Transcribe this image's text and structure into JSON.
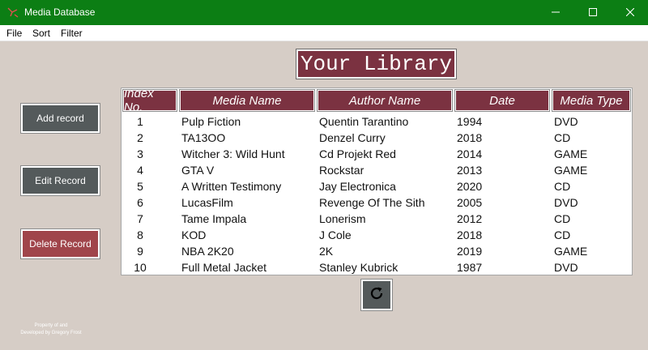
{
  "window": {
    "title": "Media Database",
    "icons": {
      "app": "app-icon",
      "minimize": "minimize-icon",
      "maximize": "maximize-icon",
      "close": "close-icon"
    },
    "colors": {
      "titlebar": "#0c7e14",
      "background": "#d6cdc6",
      "accent": "#7b3241",
      "button": "#545a5b",
      "danger": "#a0454b"
    }
  },
  "menu": {
    "file": "File",
    "sort": "Sort",
    "filter": "Filter"
  },
  "library_title": "Your Library",
  "buttons": {
    "add": "Add record",
    "edit": "Edit Record",
    "delete": "Delete Record",
    "refresh_icon": "refresh-icon"
  },
  "table": {
    "headers": {
      "index": "Index No.",
      "name": "Media Name",
      "author": "Author Name",
      "date": "Date",
      "type": "Media Type"
    },
    "rows": [
      {
        "index": "1",
        "name": "Pulp Fiction",
        "author": "Quentin Tarantino",
        "date": "1994",
        "type": "DVD"
      },
      {
        "index": "2",
        "name": "TA13OO",
        "author": "Denzel Curry",
        "date": "2018",
        "type": "CD"
      },
      {
        "index": "3",
        "name": "Witcher 3: Wild Hunt",
        "author": "Cd Projekt Red",
        "date": "2014",
        "type": "GAME"
      },
      {
        "index": "4",
        "name": "GTA V",
        "author": "Rockstar",
        "date": "2013",
        "type": "GAME"
      },
      {
        "index": "5",
        "name": "A Written Testimony",
        "author": "Jay Electronica",
        "date": "2020",
        "type": "CD"
      },
      {
        "index": "6",
        "name": "LucasFilm",
        "author": "Revenge Of The Sith",
        "date": "2005",
        "type": "DVD"
      },
      {
        "index": "7",
        "name": "Tame Impala",
        "author": "Lonerism",
        "date": "2012",
        "type": "CD"
      },
      {
        "index": "8",
        "name": "KOD",
        "author": "J Cole",
        "date": "2018",
        "type": "CD"
      },
      {
        "index": "9",
        "name": "NBA 2K20",
        "author": "2K",
        "date": "2019",
        "type": "GAME"
      },
      {
        "index": "10",
        "name": "Full Metal Jacket",
        "author": "Stanley Kubrick",
        "date": "1987",
        "type": "DVD"
      }
    ]
  },
  "credit": {
    "line1": "Property of and",
    "line2": "Developed by Gregory Frost"
  }
}
